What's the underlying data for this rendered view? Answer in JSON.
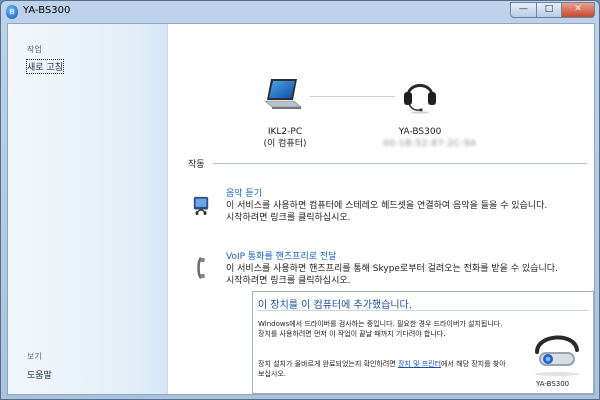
{
  "window": {
    "title": "YA-BS300",
    "title_icon": "bluetooth-icon",
    "minimize_glyph": "—",
    "maximize_glyph": "□",
    "close_glyph": "✕"
  },
  "sidebar": {
    "tasks_heading": "작업",
    "refresh_label": "새로 고침",
    "see_also_heading": "보기",
    "help_label": "도움말"
  },
  "devices": {
    "pc_name": "IKL2-PC",
    "pc_subtitle": "(이 컴퓨터)",
    "headset_name": "YA-BS300",
    "headset_address": "00:1B:52:87:2C:9A"
  },
  "operations": {
    "heading": "작동",
    "services": [
      {
        "title": "음악 듣기",
        "description": "이 서비스를 사용하면 컴퓨터에 스테레오 헤드셋을 연결하여 음악을 들을 수 있습니다. 시작하려면 링크를 클릭하십시오.",
        "icon": "music-player-icon"
      },
      {
        "title": "VoIP 통화를 핸즈프리로 전달",
        "description": "이 서비스를 사용하면 핸즈프리를 통해 Skype로부터 걸려오는 전화를 받을 수 있습니다. 시작하려면 링크를 클릭하십시오.",
        "icon": "phone-handset-icon"
      }
    ]
  },
  "notice": {
    "title": "이 장치를 이 컴퓨터에 추가했습니다.",
    "text1": "Windows에서 드라이버를 검사하는 중입니다. 필요한 경우 드라이버가 설치됩니다. 장치를 사용하려면 먼저 이 작업이 끝날 때까지 기다려야 합니다.",
    "text2_before": "장치 설치가 올바르게 완료되었는지 확인하려면 ",
    "text2_link": "장치 및 프린터",
    "text2_after": "에서 해당 장치를 찾아 보십시오.",
    "device_label": "YA-BS300"
  }
}
